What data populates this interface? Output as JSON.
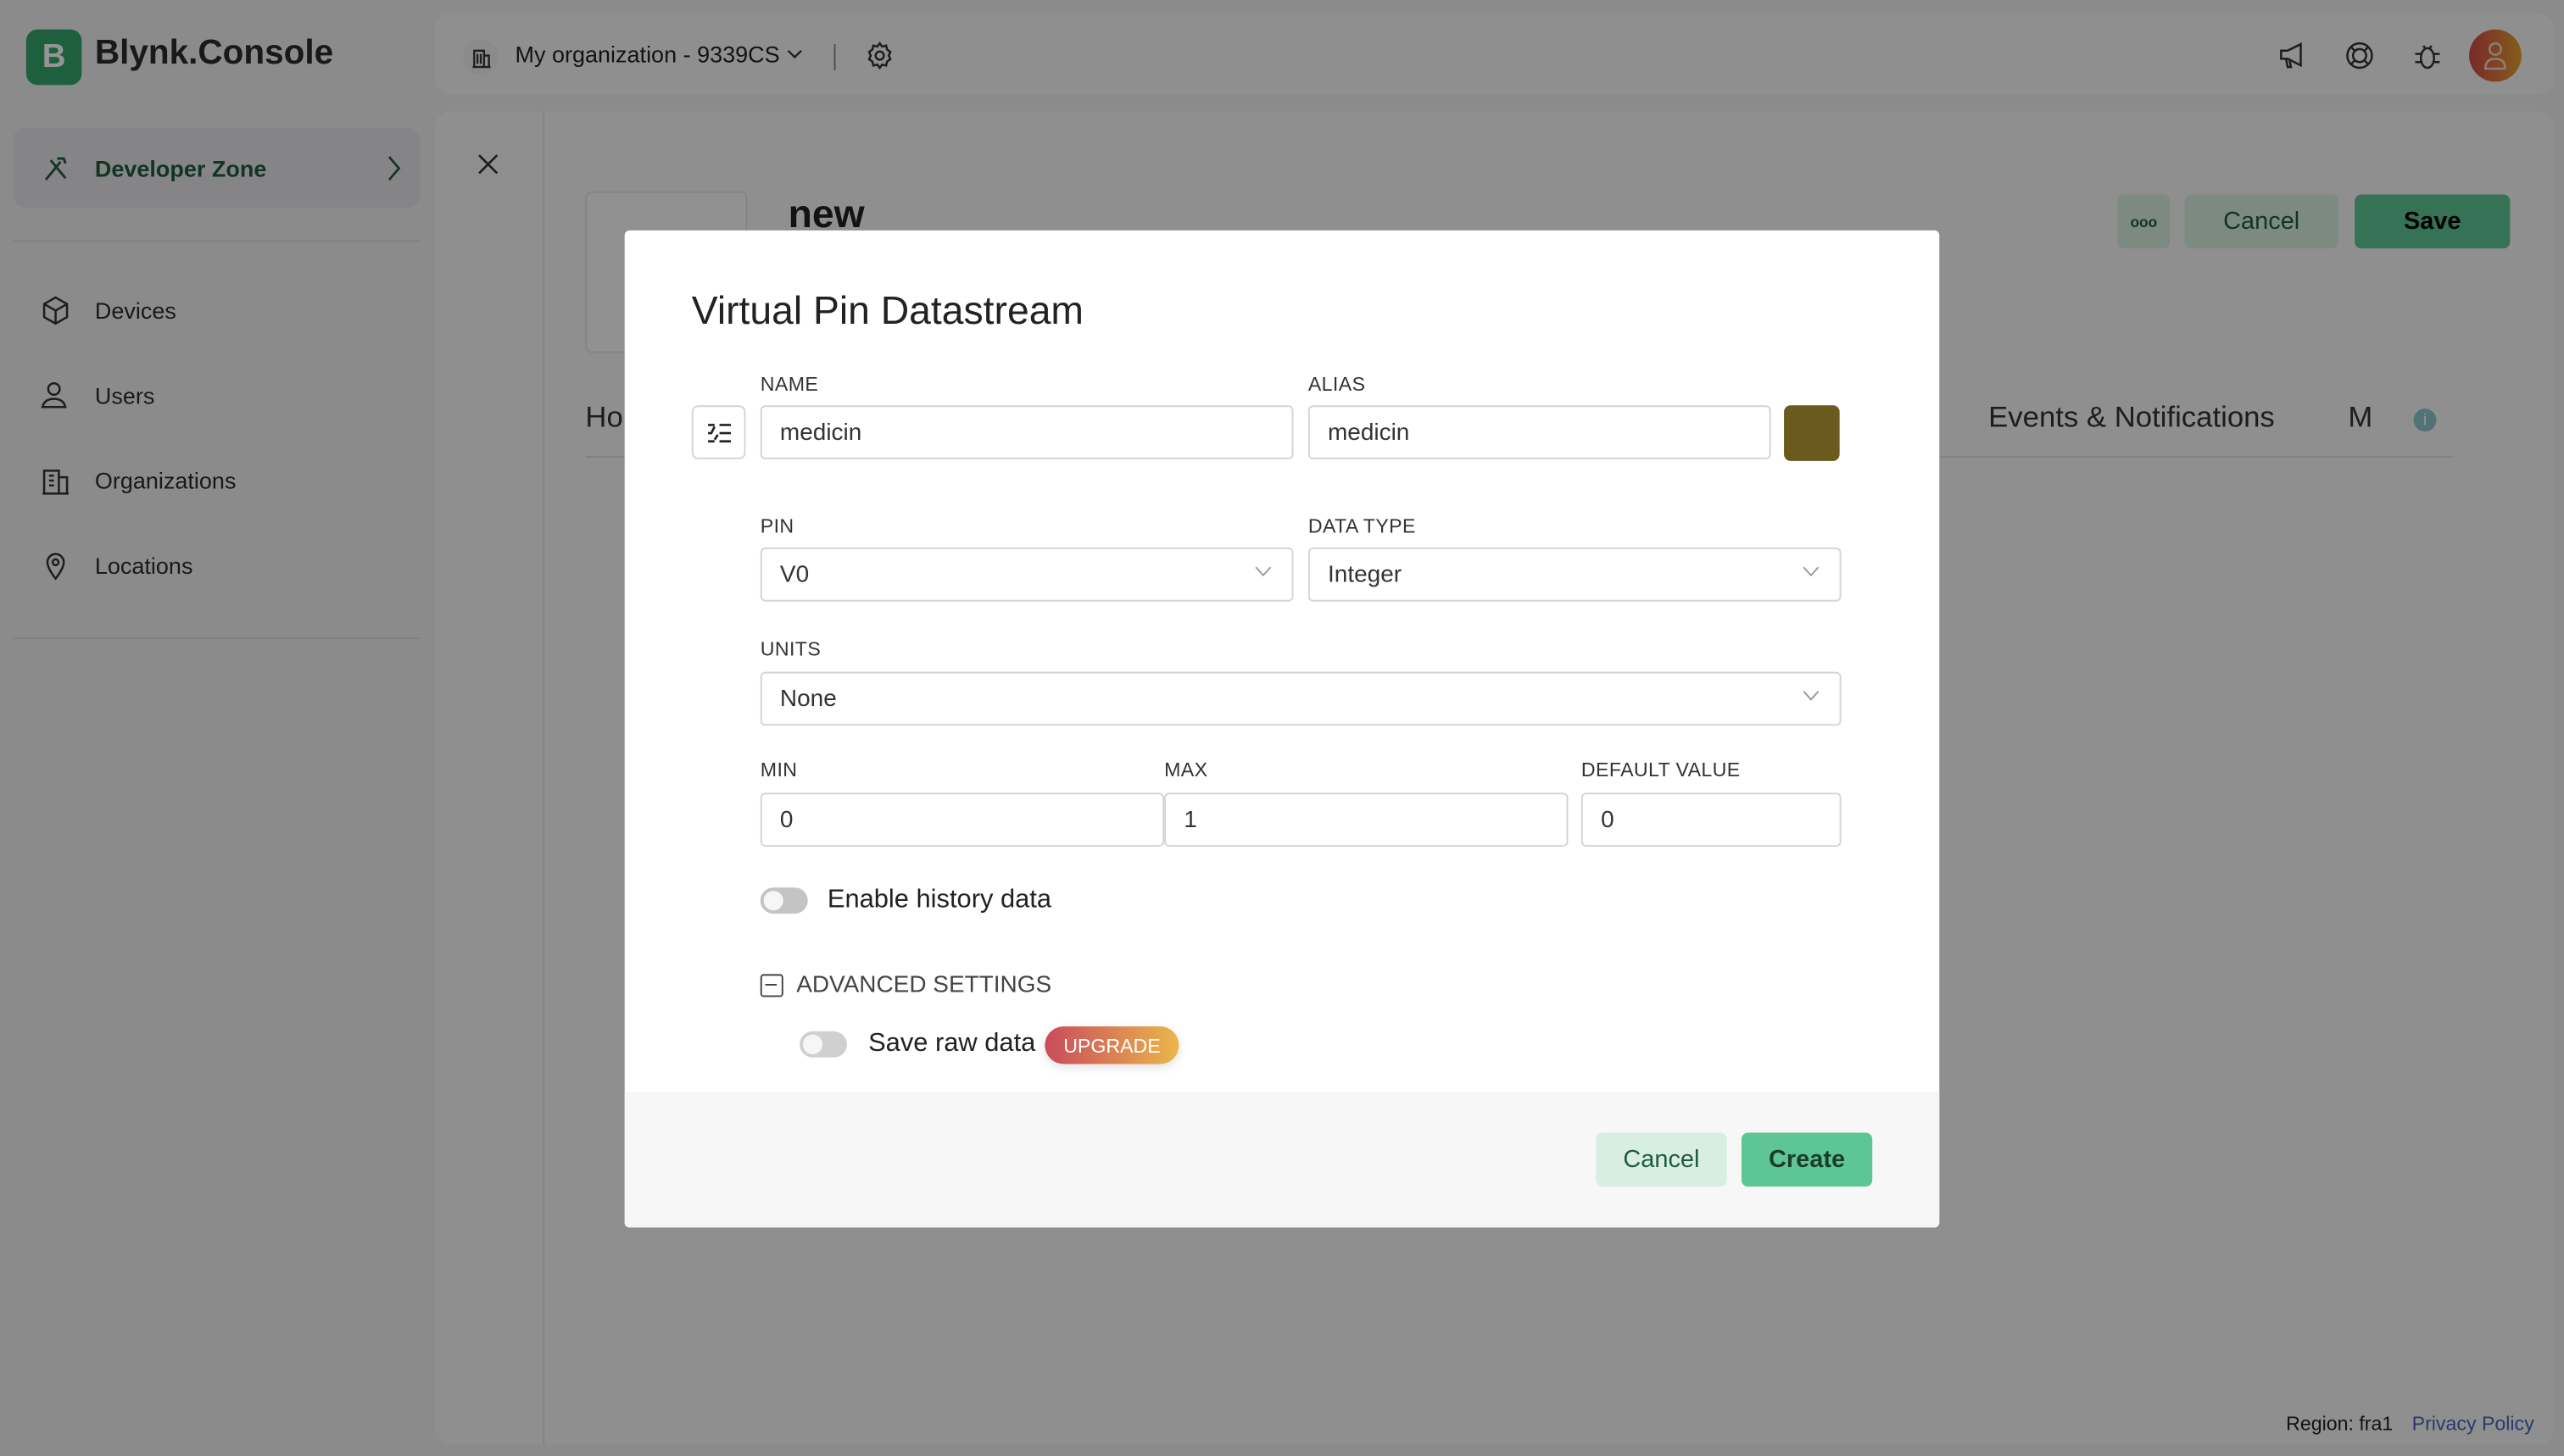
{
  "app": {
    "logo_letter": "B",
    "title": "Blynk.Console"
  },
  "header": {
    "org_label": "My organization - 9339CS",
    "icons": [
      "building-icon",
      "gear-icon",
      "megaphone-icon",
      "lifebuoy-icon",
      "bug-icon",
      "avatar"
    ]
  },
  "sidebar": {
    "developer_zone": "Developer Zone",
    "items": [
      {
        "label": "Devices",
        "icon": "cube-icon"
      },
      {
        "label": "Users",
        "icon": "users-icon"
      },
      {
        "label": "Organizations",
        "icon": "building-icon"
      },
      {
        "label": "Locations",
        "icon": "pin-icon"
      }
    ]
  },
  "page": {
    "title": "new",
    "more_label": "ooo",
    "cancel_label": "Cancel",
    "save_label": "Save",
    "tabs": [
      {
        "label": "Ho"
      },
      {
        "label": "Events & Notifications"
      },
      {
        "label": "M"
      }
    ]
  },
  "footer": {
    "region": "Region: fra1",
    "privacy": "Privacy Policy"
  },
  "modal": {
    "title": "Virtual Pin Datastream",
    "name_label": "NAME",
    "name_value": "medicin",
    "alias_label": "ALIAS",
    "alias_value": "medicin",
    "color": "#6b5a1e",
    "pin_label": "PIN",
    "pin_value": "V0",
    "data_type_label": "DATA TYPE",
    "data_type_value": "Integer",
    "units_label": "UNITS",
    "units_value": "None",
    "min_label": "MIN",
    "min_value": "0",
    "max_label": "MAX",
    "max_value": "1",
    "default_label": "DEFAULT VALUE",
    "default_value": "0",
    "history_label": "Enable history data",
    "history_enabled": false,
    "advanced_label": "ADVANCED SETTINGS",
    "raw_label": "Save raw data",
    "raw_enabled": false,
    "upgrade_label": "UPGRADE",
    "cancel_label": "Cancel",
    "create_label": "Create"
  },
  "colors": {
    "brand": "#35a66a",
    "accent_dark": "#1f5c3c",
    "upgrade_from": "#c94b5c",
    "upgrade_to": "#eab74a"
  }
}
